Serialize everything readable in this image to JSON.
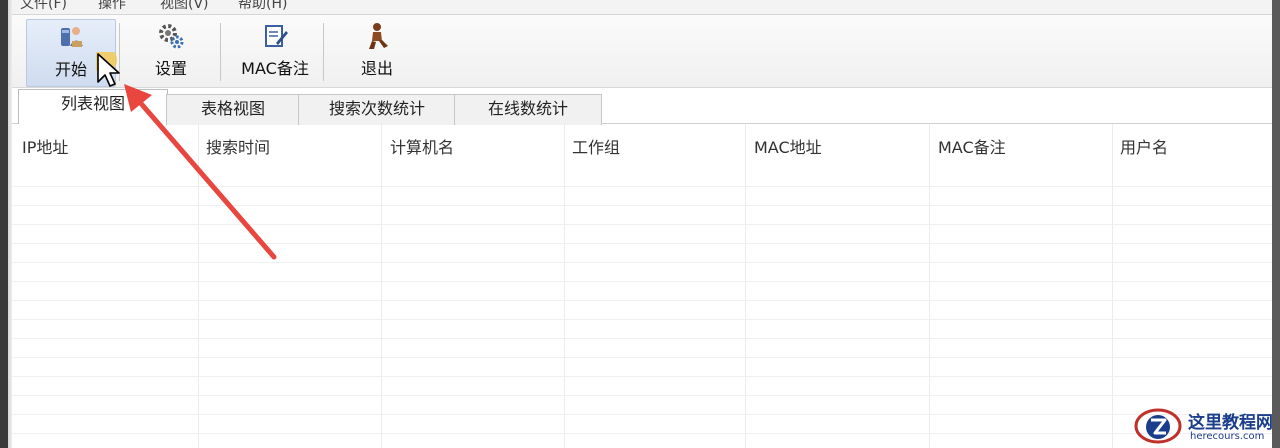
{
  "menubar": {
    "items": [
      "文件(F)",
      "操作",
      "视图(V)",
      "帮助(H)"
    ]
  },
  "toolbar": {
    "buttons": [
      {
        "label": "开始",
        "icon": "start-scan-icon"
      },
      {
        "label": "设置",
        "icon": "settings-gear-icon"
      },
      {
        "label": "MAC备注",
        "icon": "mac-note-icon"
      },
      {
        "label": "退出",
        "icon": "exit-icon"
      }
    ]
  },
  "tabs": [
    "列表视图",
    "表格视图",
    "搜索次数统计",
    "在线数统计"
  ],
  "selected_tab": "列表视图",
  "table": {
    "columns": [
      "IP地址",
      "搜索时间",
      "计算机名",
      "工作组",
      "MAC地址",
      "MAC备注",
      "用户名"
    ],
    "rows": []
  },
  "watermark": {
    "title": "这里教程网",
    "url": "herecours.com"
  },
  "colors": {
    "annotation_arrow": "#e8463f",
    "cursor_highlight": "#f5c542",
    "watermark_blue": "#1a3d8c"
  }
}
